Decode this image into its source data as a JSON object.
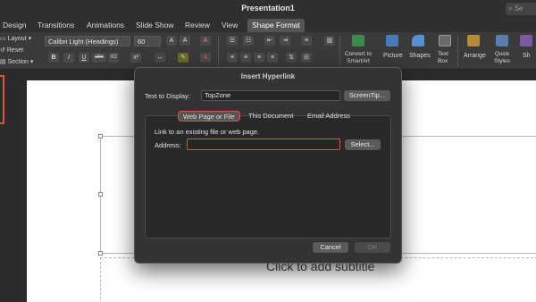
{
  "window": {
    "title": "Presentation1",
    "search_placeholder": "Se"
  },
  "tabs": [
    "Design",
    "Transitions",
    "Animations",
    "Slide Show",
    "Review",
    "View",
    "Shape Format"
  ],
  "active_tab": "Shape Format",
  "ribbon": {
    "layout": "Layout",
    "reset": "Reset",
    "section": "Section",
    "font_name": "Calibri Light (Headings)",
    "font_size": "60",
    "bold": "B",
    "italic": "I",
    "underline": "U",
    "strikethrough": "abc",
    "subscript": "X2",
    "clear_format": "A",
    "convert_to_smartart": "Convert to SmartArt",
    "picture": "Picture",
    "shapes": "Shapes",
    "text_box": "Text Box",
    "arrange": "Arrange",
    "quick_styles": "Quick Styles",
    "shape_fill": "Sh"
  },
  "slide": {
    "subtitle_placeholder": "Click to add subtitle"
  },
  "dialog": {
    "title": "Insert Hyperlink",
    "text_to_display_label": "Text to Display:",
    "text_to_display_value": "TopZone",
    "screentip_button": "ScreenTip...",
    "tabs": [
      "Web Page or File",
      "This Document",
      "Email Address"
    ],
    "active_tab": "Web Page or File",
    "instruction": "Link to an existing file or web page.",
    "address_label": "Address:",
    "address_value": "",
    "select_button": "Select...",
    "cancel_button": "Cancel",
    "ok_button": "OK"
  },
  "colors": {
    "accent": "#d4593e",
    "dialog_bg": "#333335",
    "ribbon_bg": "#3a3a3a"
  }
}
